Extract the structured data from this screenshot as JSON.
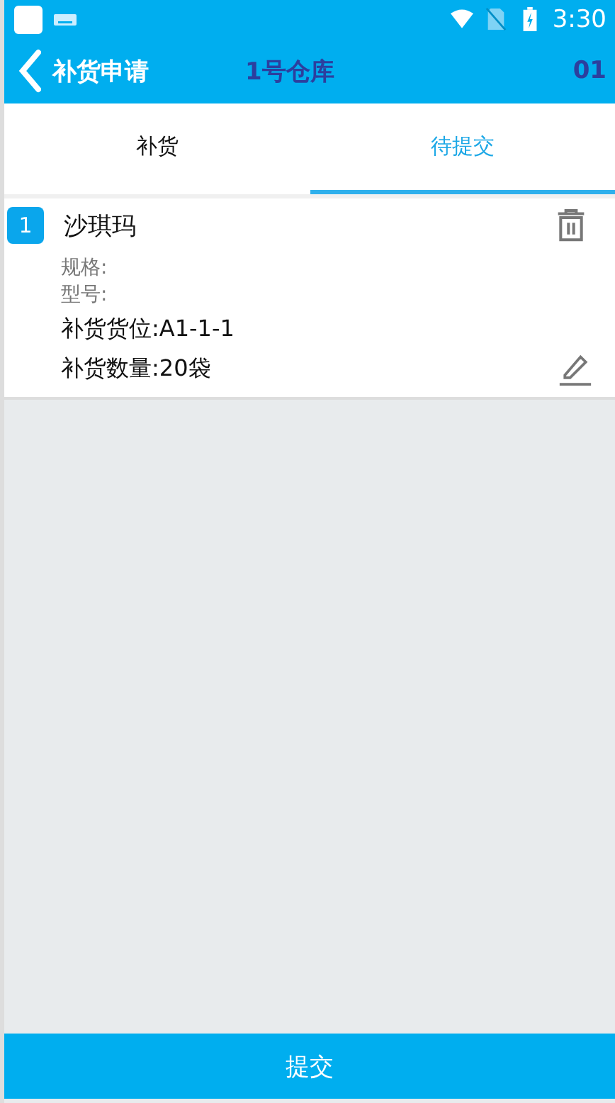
{
  "status_bar": {
    "time": "3:30"
  },
  "header": {
    "back_label": "补货申请",
    "warehouse": "1号仓库",
    "code": "01"
  },
  "tabs": [
    {
      "label": "补货",
      "selected": false
    },
    {
      "label": "待提交",
      "selected": true
    }
  ],
  "items": [
    {
      "index": "1",
      "name": "沙琪玛",
      "spec": "规格:",
      "model": "型号:",
      "location": "补货货位:A1-1-1",
      "quantity": "补货数量:20袋"
    }
  ],
  "submit_button": "提交"
}
